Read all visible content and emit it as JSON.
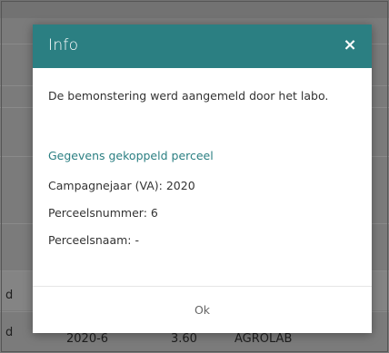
{
  "background": {
    "rows": [
      {
        "col1": "d",
        "col2": "",
        "col3": "",
        "col4": ""
      },
      {
        "col1": "d",
        "col2": "2020-6",
        "col3": "3.60",
        "col4": "AGROLAB"
      }
    ]
  },
  "modal": {
    "title": "Info",
    "close_icon": "×",
    "message": "De bemonstering werd aangemeld door het labo.",
    "section_title": "Gegevens gekoppeld perceel",
    "fields": [
      {
        "text": "Campagnejaar (VA): 2020"
      },
      {
        "text": "Perceelsnummer: 6"
      },
      {
        "text": "Perceelsnaam: -"
      }
    ],
    "ok_label": "Ok"
  },
  "colors": {
    "header": "#2b7f82",
    "section_title": "#2b7f82",
    "overlay": "#7b7b7b"
  }
}
